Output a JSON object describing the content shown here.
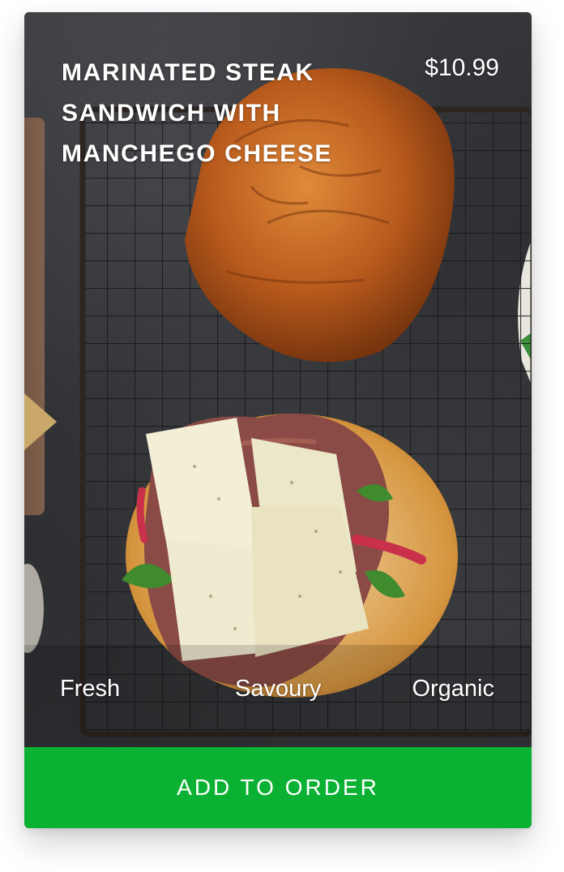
{
  "product": {
    "title": "MARINATED STEAK SANDWICH WITH MANCHEGO CHEESE",
    "price": "$10.99",
    "image_description": "photo-of-steak-sandwich-on-cooling-rack"
  },
  "tags": [
    "Fresh",
    "Savoury",
    "Organic"
  ],
  "actions": {
    "add_to_order_label": "ADD TO ORDER"
  },
  "colors": {
    "cta_background": "#0bb133",
    "text": "#ffffff",
    "photo_background": "#2e3033"
  }
}
